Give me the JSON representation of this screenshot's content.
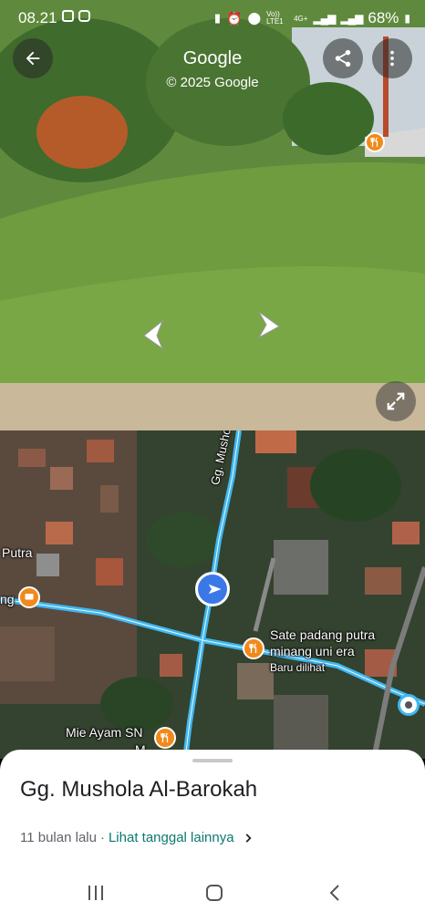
{
  "status_bar": {
    "time": "08.21",
    "network": "Vo)) LTE1",
    "network_type": "4G+",
    "battery": "68%"
  },
  "street_view": {
    "title": "Google",
    "copyright": "© 2025 Google"
  },
  "map": {
    "road_name": "Gg. Mushola Al-Barokah",
    "labels": {
      "putra": "Putra",
      "ng": "ng",
      "poi_sate_line1": "Sate padang putra",
      "poi_sate_line2": "minang uni era",
      "recently_viewed": "Baru dilihat",
      "poi_mie": "Mie Ayam SN",
      "poi_mie_cut": "M"
    }
  },
  "sheet": {
    "title": "Gg. Mushola Al-Barokah",
    "date": "11 bulan lalu",
    "separator": "·",
    "more_dates_link": "Lihat tanggal lainnya"
  },
  "colors": {
    "route": "#3fb7f0",
    "poi": "#f08a1c",
    "location_dot": "#3b78e7",
    "link": "#0b7a70"
  }
}
